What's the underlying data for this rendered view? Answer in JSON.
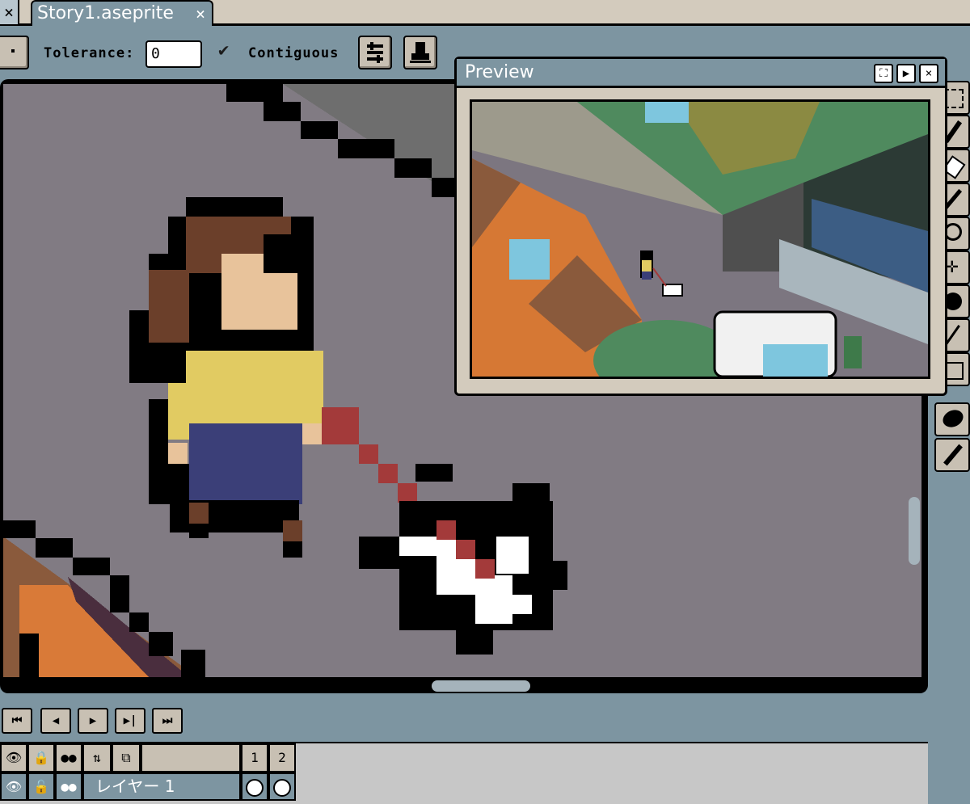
{
  "tabbar": {
    "close_glyph": "×",
    "tab_title": "Story1.aseprite",
    "tab_close": "×"
  },
  "context_bar": {
    "tolerance_label": "Tolerance:",
    "tolerance_value": "0",
    "contiguous_label": "Contiguous",
    "contiguous_checked": true,
    "check_glyph": "✔"
  },
  "preview": {
    "title": "Preview",
    "btn_fit": "⛶",
    "btn_play": "▶",
    "btn_close": "×"
  },
  "tools": [
    "marquee-icon",
    "pencil-icon",
    "eraser-icon",
    "eyedropper-icon",
    "zoom-icon",
    "move-icon",
    "paint-bucket-icon",
    "line-icon",
    "rectangle-icon",
    "blur-icon",
    "spray-icon"
  ],
  "playback": {
    "first": "⏮",
    "prev": "◀",
    "play": "▶",
    "next": "▶|",
    "last": "⏭"
  },
  "timeline": {
    "frames": [
      "1",
      "2"
    ],
    "layer_name": "レイヤー 1"
  },
  "colors": {
    "ui_blue": "#7d95a1",
    "ui_beige": "#d3cbbd",
    "canvas_gray": "#817b83"
  }
}
